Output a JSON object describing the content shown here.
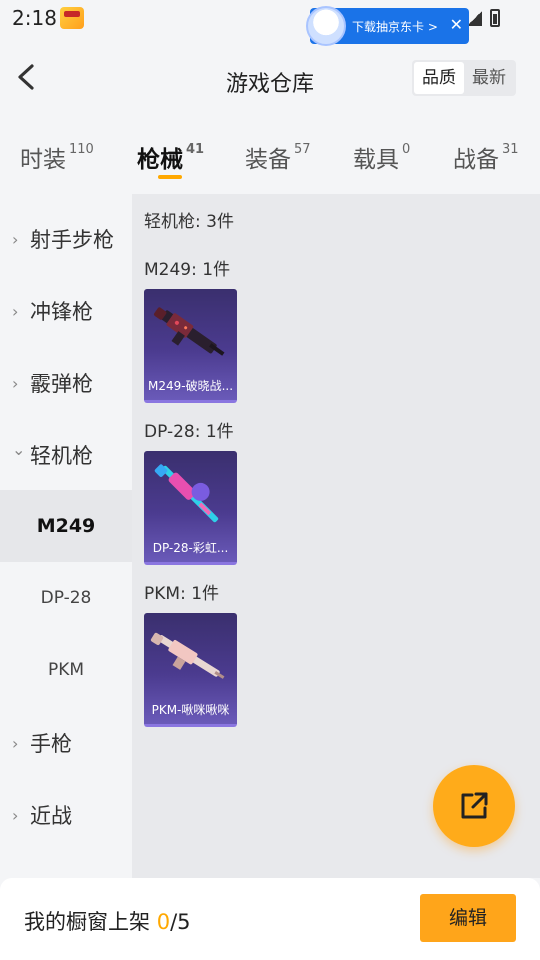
{
  "status_bar": {
    "time": "2:18"
  },
  "ad_banner": {
    "text": "下载抽京东卡 >",
    "close": "✕"
  },
  "header": {
    "title": "游戏仓库",
    "sort_options": [
      "品质",
      "最新"
    ]
  },
  "tabs": [
    {
      "label": "时装",
      "count": "110"
    },
    {
      "label": "枪械",
      "count": "41"
    },
    {
      "label": "装备",
      "count": "57"
    },
    {
      "label": "载具",
      "count": "0"
    },
    {
      "label": "战备",
      "count": "31"
    }
  ],
  "sidebar": {
    "categories": [
      {
        "label": "射手步枪",
        "chevron": "›"
      },
      {
        "label": "冲锋枪",
        "chevron": "›"
      },
      {
        "label": "霰弹枪",
        "chevron": "›"
      },
      {
        "label": "轻机枪",
        "chevron": "⌄"
      },
      {
        "label": "手枪",
        "chevron": "›"
      },
      {
        "label": "近战",
        "chevron": "›"
      }
    ],
    "subitems": [
      "M249",
      "DP-28",
      "PKM"
    ]
  },
  "content": {
    "group_title": "轻机枪: 3件",
    "sections": [
      {
        "title": "M249: 1件",
        "item": "M249-破晓战..."
      },
      {
        "title": "DP-28: 1件",
        "item": "DP-28-彩虹..."
      },
      {
        "title": "PKM: 1件",
        "item": "PKM-啾咪啾咪"
      }
    ]
  },
  "bottom_bar": {
    "label": "我的橱窗上架 ",
    "count": "0",
    "total": "/5",
    "edit": "编辑"
  },
  "colors": {
    "accent": "#ffa800",
    "card_bg": "#4b3b8f"
  }
}
